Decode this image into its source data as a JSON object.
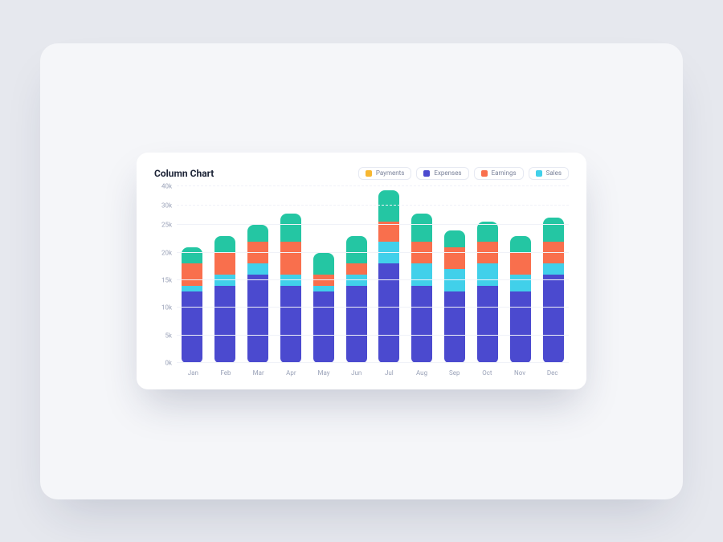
{
  "title": "Column Chart",
  "legend": [
    {
      "key": "payments",
      "label": "Payments",
      "color": "#f7b731"
    },
    {
      "key": "expenses",
      "label": "Expenses",
      "color": "#4b4acf"
    },
    {
      "key": "earnings",
      "label": "Earnings",
      "color": "#f96f4d"
    },
    {
      "key": "sales",
      "label": "Sales",
      "color": "#41d0ea"
    }
  ],
  "colors": {
    "expenses": "#4b4acf",
    "sales": "#41d0ea",
    "earnings": "#f96f4d",
    "payments": "#f7b731",
    "top": "#24c6a3"
  },
  "chart_data": {
    "type": "bar",
    "categories": [
      "Jan",
      "Feb",
      "Mar",
      "Apr",
      "May",
      "Jun",
      "Jul",
      "Aug",
      "Sep",
      "Oct",
      "Nov",
      "Dec"
    ],
    "stack_order": [
      "expenses",
      "sales",
      "earnings",
      "top"
    ],
    "series": [
      {
        "name": "expenses",
        "values": [
          13,
          14,
          16,
          14,
          13,
          14,
          18,
          14,
          13,
          14,
          13,
          16
        ]
      },
      {
        "name": "sales",
        "values": [
          1,
          2,
          2,
          2,
          1,
          2,
          4,
          4,
          4,
          4,
          3,
          2
        ]
      },
      {
        "name": "earnings",
        "values": [
          4,
          4,
          4,
          6,
          2,
          2,
          4,
          4,
          4,
          4,
          4,
          4
        ]
      },
      {
        "name": "top",
        "values": [
          3,
          3,
          3,
          6,
          4,
          5,
          12,
          6,
          3,
          4,
          3,
          5
        ]
      }
    ],
    "yticks": [
      0,
      5,
      10,
      15,
      20,
      25,
      30,
      40
    ],
    "ytick_labels": [
      "0k",
      "5k",
      "10k",
      "15k",
      "20k",
      "25k",
      "30k",
      "40k"
    ],
    "ylim": [
      0,
      40
    ],
    "xlabel": "",
    "ylabel": ""
  }
}
